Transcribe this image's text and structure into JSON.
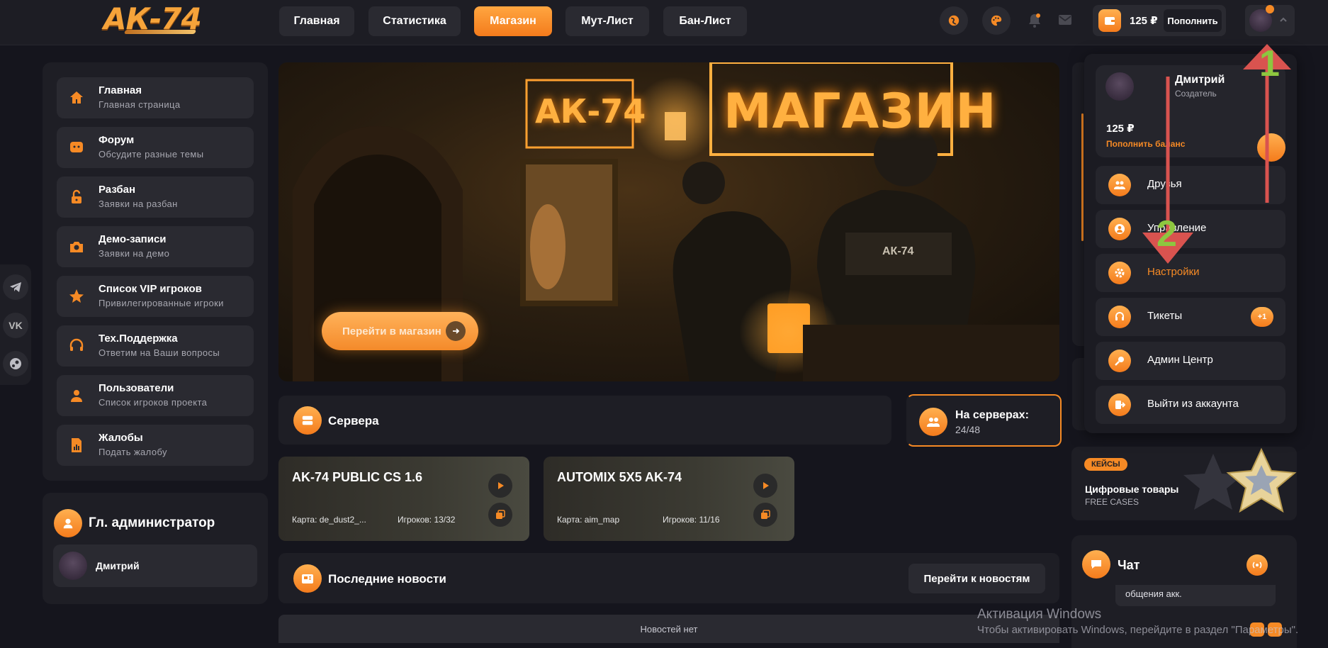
{
  "header": {
    "logo": "АК-74",
    "nav": [
      "Главная",
      "Статистика",
      "Магазин",
      "Мут-Лист",
      "Бан-Лист"
    ],
    "active_nav": "Магазин",
    "balance": "125 ₽",
    "topup_label": "Пополнить"
  },
  "sidebar": {
    "items": [
      {
        "title": "Главная",
        "subtitle": "Главная страница",
        "icon": "home-icon"
      },
      {
        "title": "Форум",
        "subtitle": "Обсудите разные темы",
        "icon": "chat-icon"
      },
      {
        "title": "Разбан",
        "subtitle": "Заявки на разбан",
        "icon": "unlock-icon"
      },
      {
        "title": "Демо-записи",
        "subtitle": "Заявки на демо",
        "icon": "camera-icon"
      },
      {
        "title": "Список VIP игроков",
        "subtitle": "Привилегированные игроки",
        "icon": "star-icon"
      },
      {
        "title": "Тех.Поддержка",
        "subtitle": "Ответим на Ваши вопросы",
        "icon": "headset-icon"
      },
      {
        "title": "Пользователи",
        "subtitle": "Список игроков проекта",
        "icon": "user-icon"
      },
      {
        "title": "Жалобы",
        "subtitle": "Подать жалобу",
        "icon": "report-icon"
      }
    ]
  },
  "admin_block": {
    "title": "Гл. администратор",
    "name": "Дмитрий"
  },
  "hero": {
    "sign_small": "АК-74",
    "sign_big": "МАГАЗИН",
    "vest_label": "АК-74",
    "cta": "Перейти в магазин"
  },
  "servers": {
    "title": "Сервера",
    "online_label": "На серверах:",
    "online_value": "24/48",
    "list": [
      {
        "name": "AK-74 PUBLIC CS 1.6",
        "map": "Карта: de_dust2_...",
        "players": "Игроков: 13/32"
      },
      {
        "name": "AUTOMIX 5X5 AK-74",
        "map": "Карта: aim_map",
        "players": "Игроков: 11/16"
      }
    ]
  },
  "news": {
    "title": "Последние новости",
    "button": "Перейти к новостям",
    "empty": "Новостей нет"
  },
  "dropdown": {
    "name": "Дмитрий",
    "role": "Создатель",
    "balance": "125 ₽",
    "topup": "Пополнить баланс",
    "items": [
      {
        "label": "Друзья",
        "icon": "friends-icon"
      },
      {
        "label": "Управление",
        "icon": "profile-icon"
      },
      {
        "label": "Настройки",
        "icon": "gear-icon"
      },
      {
        "label": "Тикеты",
        "icon": "headset-icon",
        "badge": "+1"
      },
      {
        "label": "Админ Центр",
        "icon": "key-icon"
      },
      {
        "label": "Выйти из аккаунта",
        "icon": "logout-icon"
      }
    ]
  },
  "cases": {
    "badge": "КЕЙСЫ",
    "title": "Цифровые товары",
    "subtitle": "FREE CASES"
  },
  "chat": {
    "title": "Чат",
    "snippet": "общения акк."
  },
  "annotations": {
    "marker1": "1",
    "marker2": "2"
  },
  "watermark": {
    "title": "Активация Windows",
    "text": "Чтобы активировать Windows, перейдите в раздел \"Параметры\"."
  },
  "colors": {
    "accent": "#f68a25",
    "bg": "#15151d",
    "panel": "#1e1e25",
    "item": "#2a2a31",
    "annotation_arrow": "#d9534f",
    "annotation_number": "#8dc63f"
  }
}
